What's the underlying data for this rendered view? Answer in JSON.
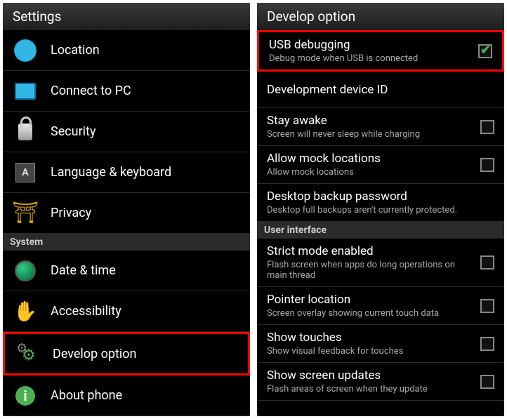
{
  "left": {
    "title": "Settings",
    "items": [
      {
        "id": "location",
        "label": "Location"
      },
      {
        "id": "connect-pc",
        "label": "Connect to PC"
      },
      {
        "id": "security",
        "label": "Security"
      },
      {
        "id": "language",
        "label": "Language & keyboard"
      },
      {
        "id": "privacy",
        "label": "Privacy"
      }
    ],
    "section": "System",
    "systemItems": [
      {
        "id": "date-time",
        "label": "Date & time"
      },
      {
        "id": "accessibility",
        "label": "Accessibility"
      },
      {
        "id": "develop-option",
        "label": "Develop option",
        "highlight": true
      },
      {
        "id": "about-phone",
        "label": "About phone"
      }
    ]
  },
  "right": {
    "title": "Develop option",
    "items": [
      {
        "id": "usb-debugging",
        "title": "USB debugging",
        "desc": "Debug mode when USB is connected",
        "checked": true,
        "highlight": true,
        "checkbox": true
      },
      {
        "id": "dev-device-id",
        "title": "Development device ID",
        "checkbox": false
      },
      {
        "id": "stay-awake",
        "title": "Stay awake",
        "desc": "Screen will never sleep while charging",
        "checked": false,
        "checkbox": true
      },
      {
        "id": "mock-locations",
        "title": "Allow mock locations",
        "desc": "Allow mock locations",
        "checked": false,
        "checkbox": true
      },
      {
        "id": "backup-password",
        "title": "Desktop backup password",
        "desc": "Desktop full backups aren't currently protected.",
        "checkbox": false
      }
    ],
    "section": "User interface",
    "uiItems": [
      {
        "id": "strict-mode",
        "title": "Strict mode enabled",
        "desc": "Flash screen when apps do long operations on main thread",
        "checked": false,
        "checkbox": true
      },
      {
        "id": "pointer-location",
        "title": "Pointer location",
        "desc": "Screen overlay showing current touch data",
        "checked": false,
        "checkbox": true
      },
      {
        "id": "show-touches",
        "title": "Show touches",
        "desc": "Show visual feedback for touches",
        "checked": false,
        "checkbox": true
      },
      {
        "id": "screen-updates",
        "title": "Show screen updates",
        "desc": "Flash areas of screen when they update",
        "checked": false,
        "checkbox": true
      }
    ]
  }
}
